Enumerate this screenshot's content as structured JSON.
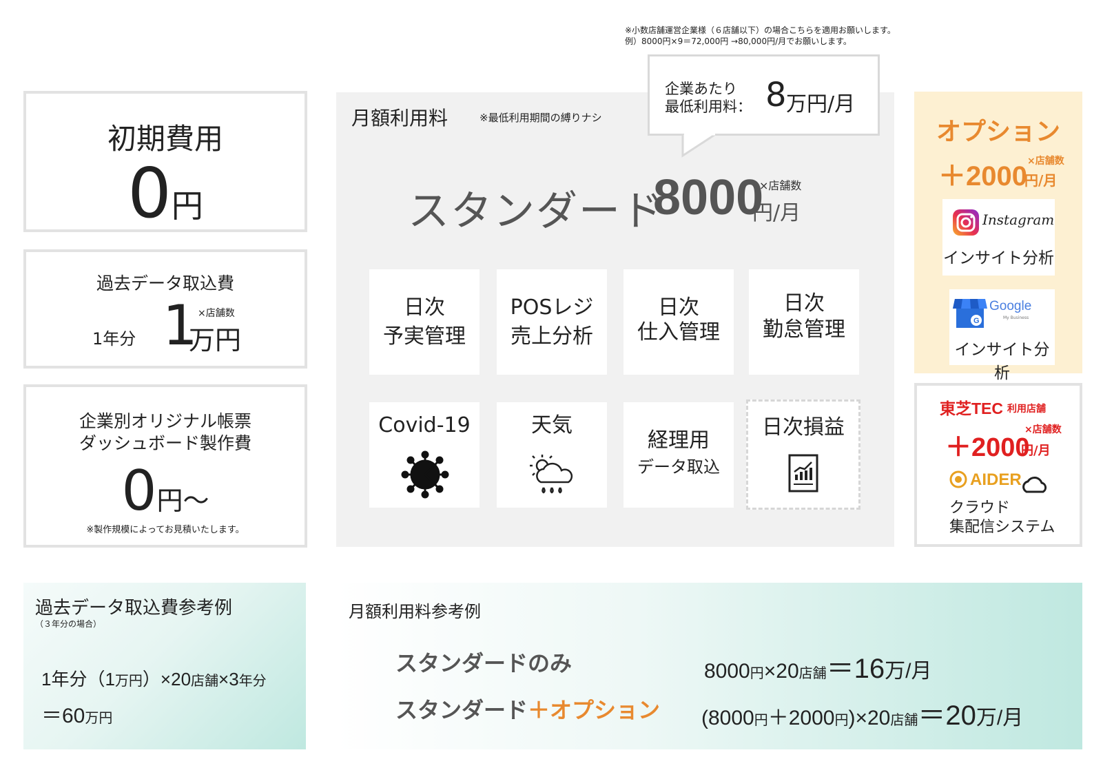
{
  "top_note": {
    "line1": "※小数店舗運営企業様（６店舗以下）の場合こちらを適用お願いします。",
    "line2": "例）8000円×9＝72,000円 →80,000円/月でお願いします。"
  },
  "initial_fee": {
    "title": "初期費用",
    "value": "0",
    "unit": "円"
  },
  "import_fee": {
    "title": "過去データ取込費",
    "period": "1年分",
    "value": "1",
    "unit": "万円",
    "per_store": "×店舗数"
  },
  "report_fee": {
    "title_line1": "企業別オリジナル帳票",
    "title_line2": "ダッシュボード製作費",
    "value": "0",
    "unit": "円～",
    "note": "※製作規模によってお見積いたします。"
  },
  "monthly": {
    "title": "月額利用料",
    "note": "※最低利用期間の縛りナシ",
    "callout_line1": "企業あたり",
    "callout_line2": "最低利用料：",
    "callout_value": "8",
    "callout_unit": "万円/月",
    "plan_name": "スタンダード",
    "plan_price": "8000",
    "plan_unit": "円/月",
    "plan_per_store": "×店舗数",
    "features": [
      {
        "line1": "日次",
        "line2": "予実管理"
      },
      {
        "line1": "POSレジ",
        "line2": "売上分析"
      },
      {
        "line1": "日次",
        "line2": "仕入管理"
      },
      {
        "line1": "日次",
        "line2": "勤怠管理"
      },
      {
        "line1": "Covid-19",
        "line2": ""
      },
      {
        "line1": "天気",
        "line2": ""
      },
      {
        "line1": "経理用",
        "line2": "データ取込"
      },
      {
        "line1": "日次損益",
        "line2": ""
      }
    ]
  },
  "option": {
    "title": "オプション",
    "price": "＋2000",
    "unit": "円/月",
    "per_store": "×店舗数",
    "instagram_logo": "Instagram",
    "instagram_label": "インサイト分析",
    "google_logo": "Google",
    "google_sub": "My Business",
    "google_label": "インサイト分析"
  },
  "toshiba": {
    "title": "東芝TEC",
    "sub": "利用店舗",
    "price": "＋2000",
    "unit": "円/月",
    "per_store": "×店舗数",
    "logo": "AIDER",
    "line1": "クラウド",
    "line2": "集配信システム"
  },
  "example_import": {
    "title": "過去データ取込費参考例",
    "sub": "（３年分の場合）",
    "a1": "1年分（1",
    "a2": "万円",
    "a3": "）×20",
    "a4": "店舗",
    "a5": "×3",
    "a6": "年分",
    "b1": "＝60",
    "b2": "万円"
  },
  "example_monthly": {
    "title": "月額利用料参考例",
    "row1_label": "スタンダードのみ",
    "row1_a": "8000",
    "row1_b": "円",
    "row1_c": "×20",
    "row1_d": "店舗",
    "row1_e": "＝16",
    "row1_f": "万/月",
    "row2_label_a": "スタンダード",
    "row2_label_b": "＋オプション",
    "row2_a": "(8000",
    "row2_b": "円",
    "row2_c": "＋2000",
    "row2_d": "円",
    "row2_e": ")×20",
    "row2_f": "店舗",
    "row2_g": "＝20",
    "row2_h": "万/月"
  },
  "colors": {
    "orange": "#e8892f",
    "red": "#e02020",
    "panel_gray": "#f1f1f1",
    "option_bg": "#fdf0d2"
  }
}
